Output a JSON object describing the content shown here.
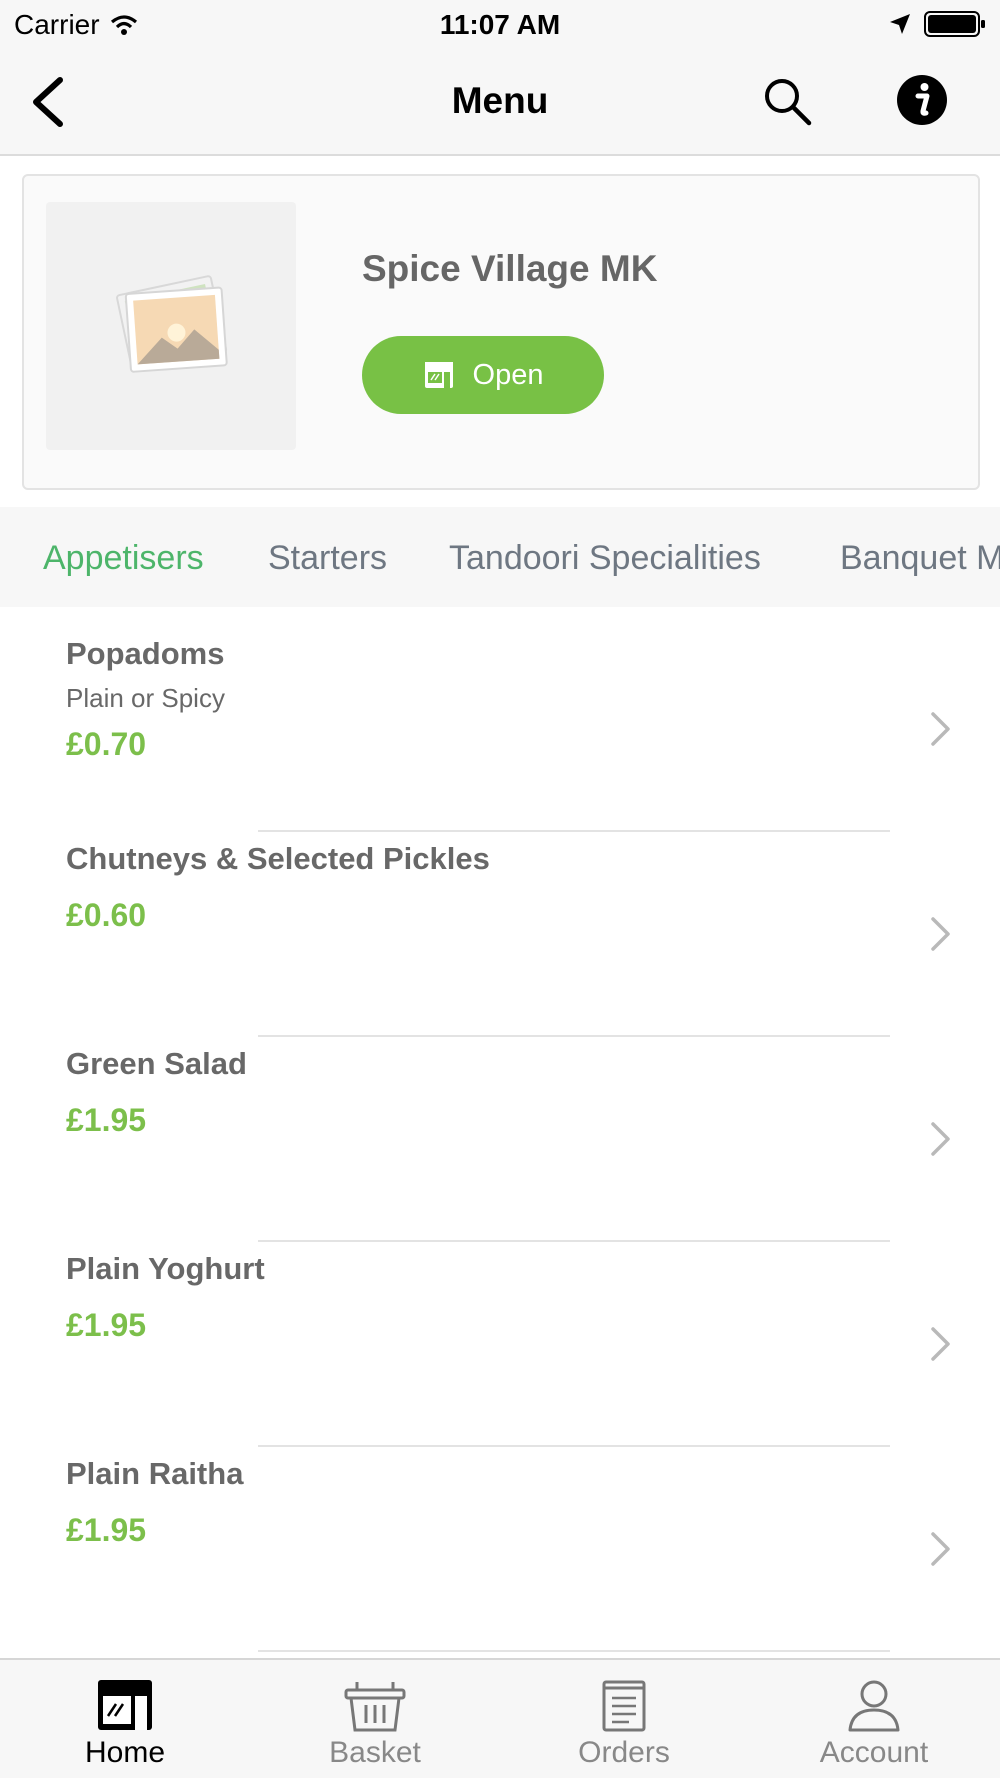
{
  "status_bar": {
    "carrier": "Carrier",
    "time": "11:07 AM"
  },
  "nav": {
    "title": "Menu"
  },
  "restaurant": {
    "name": "Spice Village MK",
    "status_label": "Open"
  },
  "categories": [
    {
      "label": "Appetisers",
      "active": true
    },
    {
      "label": "Starters",
      "active": false
    },
    {
      "label": "Tandoori Specialities",
      "active": false
    },
    {
      "label": "Banquet M",
      "active": false
    }
  ],
  "menu_items": [
    {
      "name": "Popadoms",
      "description": "Plain or Spicy",
      "price": "£0.70"
    },
    {
      "name": "Chutneys & Selected Pickles",
      "description": "",
      "price": "£0.60"
    },
    {
      "name": "Green Salad",
      "description": "",
      "price": "£1.95"
    },
    {
      "name": "Plain Yoghurt",
      "description": "",
      "price": "£1.95"
    },
    {
      "name": "Plain Raitha",
      "description": "",
      "price": "£1.95"
    }
  ],
  "tab_bar": [
    {
      "label": "Home",
      "icon": "shop-icon",
      "active": true
    },
    {
      "label": "Basket",
      "icon": "basket-icon",
      "active": false
    },
    {
      "label": "Orders",
      "icon": "receipt-icon",
      "active": false
    },
    {
      "label": "Account",
      "icon": "person-icon",
      "active": false
    }
  ],
  "colors": {
    "accent_green": "#78c145",
    "price_green": "#7cbf4b",
    "active_tab_green": "#4db56a"
  }
}
